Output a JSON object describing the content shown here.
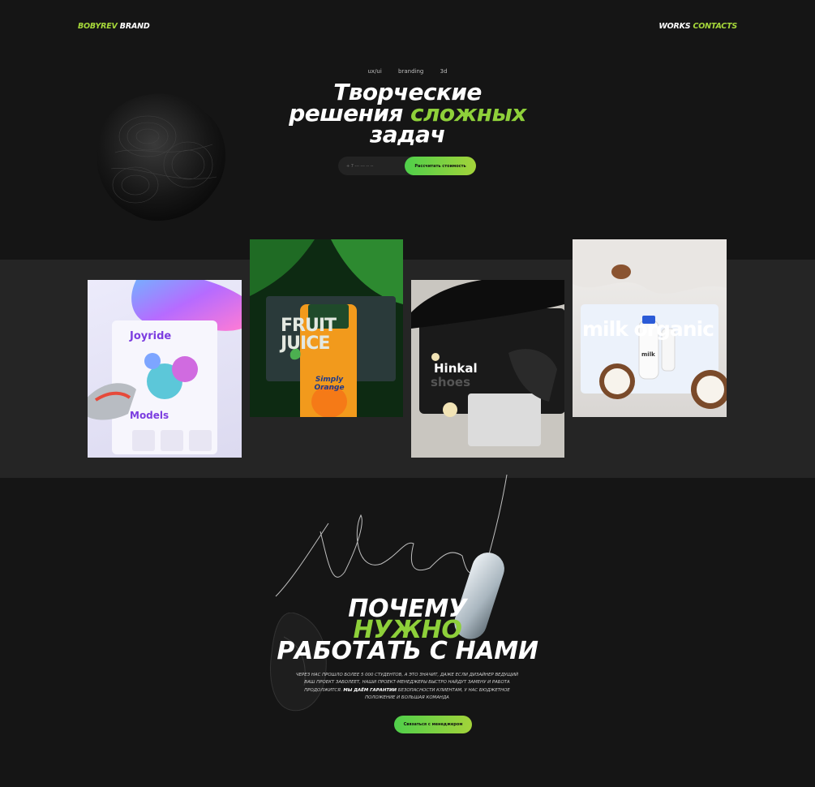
{
  "header": {
    "brand_part1": "BOBYREV",
    "brand_part2": "BRAND",
    "nav_works": "WORKS",
    "nav_contacts": "CONTACTS"
  },
  "hero": {
    "tags": [
      "ux/ui",
      "branding",
      "3d"
    ],
    "title_line1": "Творческие",
    "title_line2_word1": "решения",
    "title_line2_accent": "сложных",
    "title_line3": "задач",
    "phone_placeholder": "+ 7 --- --- -- --",
    "calc_button": "Рассчитать стоимость"
  },
  "works": {
    "cards": [
      {
        "name": "joyride",
        "title": "Joyride",
        "subtitle": "Models"
      },
      {
        "name": "fruit-juice",
        "title": "FRUIT JUICE",
        "product": "Simply Orange"
      },
      {
        "name": "hinkal",
        "title": "Hinkal",
        "subtitle": "shoes"
      },
      {
        "name": "milk-organic",
        "title": "milk organic",
        "product": "milk"
      }
    ]
  },
  "why": {
    "title_line1": "ПОЧЕМУ",
    "title_line2": "НУЖНО",
    "title_line3": "РАБОТАТЬ С НАМИ",
    "desc_part1": "Через нас прошло более 5 000 студентов, а это значит, даже если дизайнер ведущий ваш проект заболеет, наши проект-менеджеры быстро найдут замену и работа продолжится.",
    "desc_bold": "Мы даём гарантии",
    "desc_part2": "безопасности клиентам, у нас бюджетное положение и большая команда",
    "contact_button": "Связаться с менеджером"
  },
  "colors": {
    "background": "#151515",
    "band": "#252525",
    "accent_green": "#8ed03a"
  }
}
